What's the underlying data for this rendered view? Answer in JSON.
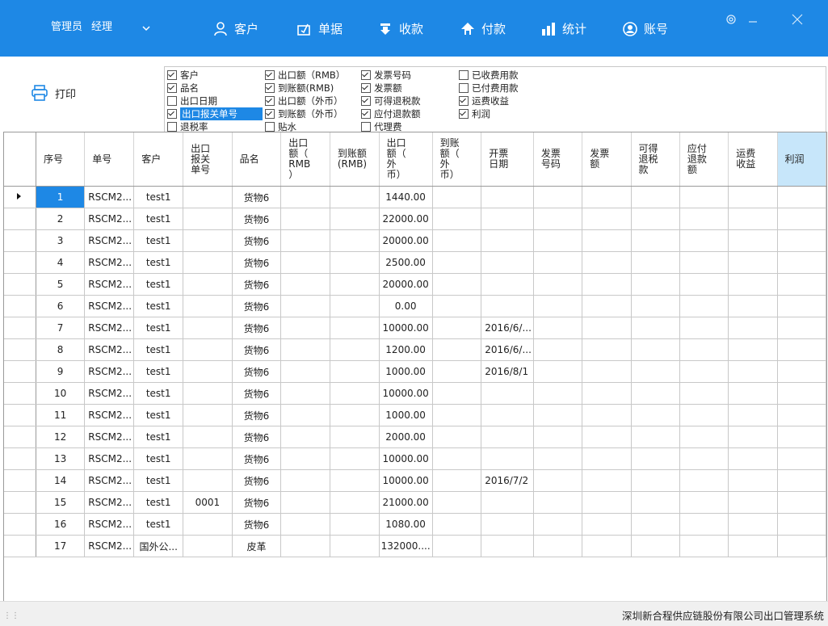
{
  "header": {
    "role": "管理员",
    "user": "经理",
    "nav": [
      {
        "id": "customer",
        "label": "客户",
        "icon": "person-icon"
      },
      {
        "id": "docs",
        "label": "单据",
        "icon": "document-icon"
      },
      {
        "id": "receipt",
        "label": "收款",
        "icon": "download-icon"
      },
      {
        "id": "payment",
        "label": "付款",
        "icon": "home-upload-icon"
      },
      {
        "id": "stats",
        "label": "统计",
        "icon": "bar-chart-icon"
      },
      {
        "id": "account",
        "label": "账号",
        "icon": "user-circle-icon"
      }
    ],
    "accent": "#1e88e5"
  },
  "toolbar": {
    "print_label": "打印",
    "options": [
      {
        "label": "客户",
        "checked": true
      },
      {
        "label": "品名",
        "checked": true
      },
      {
        "label": "出口日期",
        "checked": false
      },
      {
        "label": "出口报关单号",
        "checked": true,
        "selected": true
      },
      {
        "label": "退税率",
        "checked": false
      },
      {
        "label": "出口额（RMB）",
        "checked": true
      },
      {
        "label": "到账额(RMB)",
        "checked": true
      },
      {
        "label": "出口额（外币）",
        "checked": true
      },
      {
        "label": "到账额（外币）",
        "checked": true
      },
      {
        "label": "贴水",
        "checked": false
      },
      {
        "label": "发票号码",
        "checked": true
      },
      {
        "label": "发票额",
        "checked": true
      },
      {
        "label": "可得退税款",
        "checked": true
      },
      {
        "label": "应付退款额",
        "checked": true
      },
      {
        "label": "代理费",
        "checked": false
      },
      {
        "label": "已收费用款",
        "checked": false
      },
      {
        "label": "已付费用款",
        "checked": false
      },
      {
        "label": "运费收益",
        "checked": true
      },
      {
        "label": "利润",
        "checked": true
      }
    ]
  },
  "grid": {
    "columns": [
      "序号",
      "单号",
      "客户",
      "出口\n报关\n单号",
      "品名",
      "出口\n额（\nRMB\n）",
      "到账额\n(RMB)",
      "出口\n额（\n外\n币）",
      "到账\n额（\n外\n币）",
      "开票\n日期",
      "发票\n号码",
      "发票\n额",
      "可得\n退税\n款",
      "应付\n退款\n额",
      "运费\n收益",
      "利润"
    ],
    "rows": [
      [
        "1",
        "RSCM2...",
        "test1",
        "",
        "货物6",
        "",
        "",
        "1440.00",
        "",
        "",
        "",
        "",
        "",
        "",
        "",
        ""
      ],
      [
        "2",
        "RSCM2...",
        "test1",
        "",
        "货物6",
        "",
        "",
        "22000.00",
        "",
        "",
        "",
        "",
        "",
        "",
        "",
        ""
      ],
      [
        "3",
        "RSCM2...",
        "test1",
        "",
        "货物6",
        "",
        "",
        "20000.00",
        "",
        "",
        "",
        "",
        "",
        "",
        "",
        ""
      ],
      [
        "4",
        "RSCM2...",
        "test1",
        "",
        "货物6",
        "",
        "",
        "2500.00",
        "",
        "",
        "",
        "",
        "",
        "",
        "",
        ""
      ],
      [
        "5",
        "RSCM2...",
        "test1",
        "",
        "货物6",
        "",
        "",
        "20000.00",
        "",
        "",
        "",
        "",
        "",
        "",
        "",
        ""
      ],
      [
        "6",
        "RSCM2...",
        "test1",
        "",
        "货物6",
        "",
        "",
        "0.00",
        "",
        "",
        "",
        "",
        "",
        "",
        "",
        ""
      ],
      [
        "7",
        "RSCM2...",
        "test1",
        "",
        "货物6",
        "",
        "",
        "10000.00",
        "",
        "2016/6/...",
        "",
        "",
        "",
        "",
        "",
        ""
      ],
      [
        "8",
        "RSCM2...",
        "test1",
        "",
        "货物6",
        "",
        "",
        "1200.00",
        "",
        "2016/6/...",
        "",
        "",
        "",
        "",
        "",
        ""
      ],
      [
        "9",
        "RSCM2...",
        "test1",
        "",
        "货物6",
        "",
        "",
        "1000.00",
        "",
        "2016/8/1",
        "",
        "",
        "",
        "",
        "",
        ""
      ],
      [
        "10",
        "RSCM2...",
        "test1",
        "",
        "货物6",
        "",
        "",
        "10000.00",
        "",
        "",
        "",
        "",
        "",
        "",
        "",
        ""
      ],
      [
        "11",
        "RSCM2...",
        "test1",
        "",
        "货物6",
        "",
        "",
        "1000.00",
        "",
        "",
        "",
        "",
        "",
        "",
        "",
        ""
      ],
      [
        "12",
        "RSCM2...",
        "test1",
        "",
        "货物6",
        "",
        "",
        "2000.00",
        "",
        "",
        "",
        "",
        "",
        "",
        "",
        ""
      ],
      [
        "13",
        "RSCM2...",
        "test1",
        "",
        "货物6",
        "",
        "",
        "10000.00",
        "",
        "",
        "",
        "",
        "",
        "",
        "",
        ""
      ],
      [
        "14",
        "RSCM2...",
        "test1",
        "",
        "货物6",
        "",
        "",
        "10000.00",
        "",
        "2016/7/2",
        "",
        "",
        "",
        "",
        "",
        ""
      ],
      [
        "15",
        "RSCM2...",
        "test1",
        "0001",
        "货物6",
        "",
        "",
        "21000.00",
        "",
        "",
        "",
        "",
        "",
        "",
        "",
        ""
      ],
      [
        "16",
        "RSCM2...",
        "test1",
        "",
        "货物6",
        "",
        "",
        "1080.00",
        "",
        "",
        "",
        "",
        "",
        "",
        "",
        ""
      ],
      [
        "17",
        "RSCM2...",
        "国外公...",
        "",
        "皮革",
        "",
        "",
        "132000....",
        "",
        "",
        "",
        "",
        "",
        "",
        "",
        ""
      ]
    ]
  },
  "status": {
    "text": "深圳新合程供应链股份有限公司出口管理系统"
  }
}
